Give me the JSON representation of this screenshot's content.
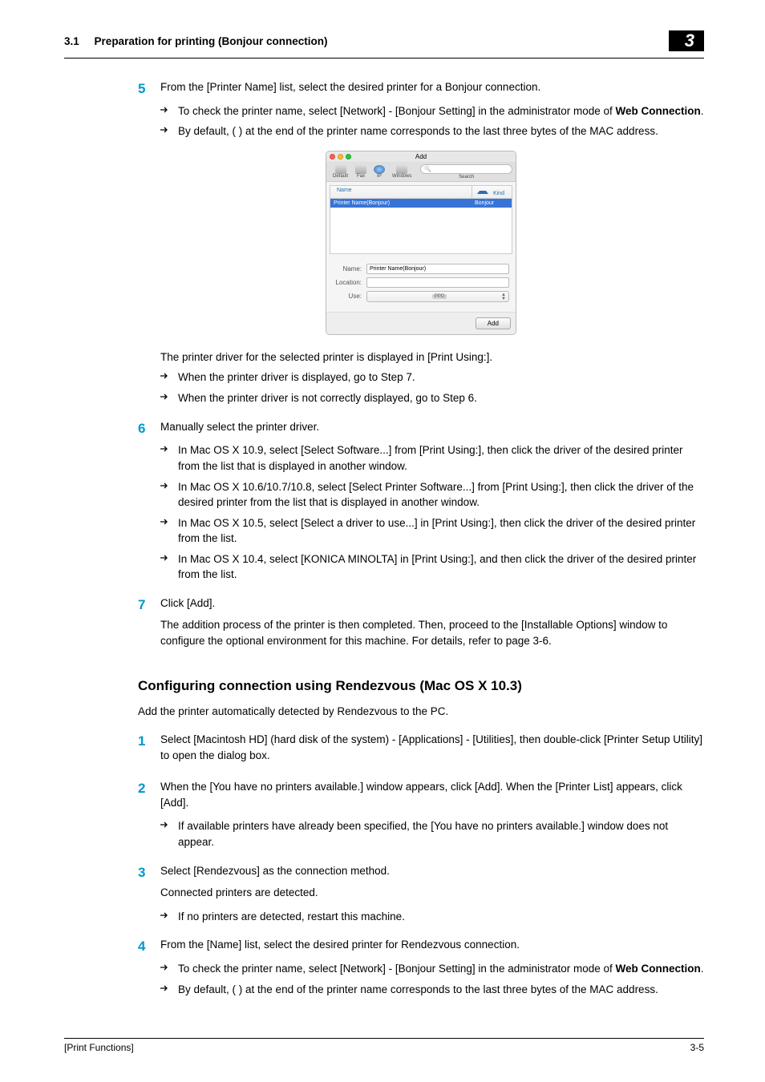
{
  "header": {
    "section_num": "3.1",
    "section_title": "Preparation for printing (Bonjour connection)",
    "chapter_num": "3"
  },
  "body": {
    "step5": {
      "num": "5",
      "text": "From the [Printer Name] list, select the desired printer for a Bonjour connection.",
      "sub1_a": "To check the printer name, select [Network] - [Bonjour Setting] in the administrator mode of ",
      "sub1_b": "Web Connection",
      "sub1_c": ".",
      "sub2": "By default, ( ) at the end of the printer name corresponds to the last three bytes of the MAC address."
    },
    "dialog": {
      "title": "Add",
      "toolbar": {
        "default": "Default",
        "fax": "Fax",
        "ip": "IP",
        "windows": "Windows",
        "search": "Search"
      },
      "list": {
        "col_name": "Name",
        "col_kind": "Kind",
        "row_name": "Printer Name(Bonjour)",
        "row_kind": "Bonjour"
      },
      "form": {
        "name_label": "Name:",
        "name_value": "Printer Name(Bonjour)",
        "location_label": "Location:",
        "use_label": "Use:",
        "use_value": "",
        "ppd": "PPD"
      },
      "footer_btn": "Add"
    },
    "after5": {
      "p1": "The printer driver for the selected printer is displayed in [Print Using:].",
      "sub1": "When the printer driver is displayed, go to Step 7.",
      "sub2": "When the printer driver is not correctly displayed, go to Step 6."
    },
    "step6": {
      "num": "6",
      "text": "Manually select the printer driver.",
      "sub1": "In Mac OS X 10.9, select [Select Software...] from [Print Using:], then click the driver of the desired printer from the list that is displayed in another window.",
      "sub2": "In Mac OS X 10.6/10.7/10.8, select [Select Printer Software...] from [Print Using:], then click the driver of the desired printer from the list that is displayed in another window.",
      "sub3": "In Mac OS X 10.5, select [Select a driver to use...] in [Print Using:], then click the driver of the desired printer from the list.",
      "sub4": "In Mac OS X 10.4, select [KONICA MINOLTA] in [Print Using:], and then click the driver of the desired printer from the list."
    },
    "step7": {
      "num": "7",
      "text": "Click [Add].",
      "p1": "The addition process of the printer is then completed. Then, proceed to the [Installable Options] window to configure the optional environment for this machine. For details, refer to page 3-6."
    },
    "heading2": "Configuring connection using Rendezvous (Mac OS X 10.3)",
    "intro2": "Add the printer automatically detected by Rendezvous to the PC.",
    "r_step1": {
      "num": "1",
      "text": "Select [Macintosh HD] (hard disk of the system) - [Applications] - [Utilities], then double-click [Printer Setup Utility] to open the dialog box."
    },
    "r_step2": {
      "num": "2",
      "text": "When the [You have no printers available.] window appears, click [Add]. When the [Printer List] appears, click [Add].",
      "sub1": "If available printers have already been specified, the [You have no printers available.] window does not appear."
    },
    "r_step3": {
      "num": "3",
      "text": "Select [Rendezvous] as the connection method.",
      "p1": "Connected printers are detected.",
      "sub1": "If no printers are detected, restart this machine."
    },
    "r_step4": {
      "num": "4",
      "text": "From the [Name] list, select the desired printer for Rendezvous connection.",
      "sub1_a": "To check the printer name, select [Network] - [Bonjour Setting] in the administrator mode of ",
      "sub1_b": "Web Connection",
      "sub1_c": ".",
      "sub2": "By default, ( ) at the end of the printer name corresponds to the last three bytes of the MAC address."
    }
  },
  "footer": {
    "left": "[Print Functions]",
    "right": "3-5"
  }
}
